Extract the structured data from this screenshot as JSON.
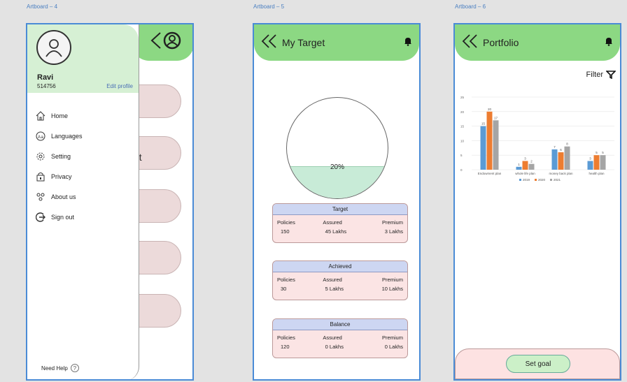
{
  "artboards": {
    "a4": "Artboard – 4",
    "a5": "Artboard – 5",
    "a6": "Artboard – 6"
  },
  "drawer": {
    "user_name": "Ravi",
    "user_id": "514756",
    "edit_profile": "Edit profile",
    "menu": [
      {
        "label": "Home",
        "icon": "home-icon"
      },
      {
        "label": "Languages",
        "icon": "languages-icon"
      },
      {
        "label": "Setting",
        "icon": "gear-icon"
      },
      {
        "label": "Privacy",
        "icon": "privacy-icon"
      },
      {
        "label": "About us",
        "icon": "about-icon"
      },
      {
        "label": "Sign out",
        "icon": "sign-out-icon"
      }
    ],
    "need_help": "Need Help",
    "help_glyph": "?",
    "behind_text": "nt"
  },
  "target": {
    "title": "My Target",
    "progress_label": "20%",
    "progress_fraction": 0.2,
    "cards": [
      {
        "heading": "Target",
        "labels": [
          "Policies",
          "Assured",
          "Premium"
        ],
        "values": [
          "150",
          "45 Lakhs",
          "3 Lakhs"
        ]
      },
      {
        "heading": "Achieved",
        "labels": [
          "Policies",
          "Assured",
          "Premium"
        ],
        "values": [
          "30",
          "5 Lakhs",
          "10 Lakhs"
        ]
      },
      {
        "heading": "Balance",
        "labels": [
          "Policies",
          "Assured",
          "Premium"
        ],
        "values": [
          "120",
          "0 Lakhs",
          "0 Lakhs"
        ]
      }
    ]
  },
  "portfolio": {
    "title": "Portfolio",
    "filter_label": "Filter",
    "set_goal": "Set goal"
  },
  "colors": {
    "header_green": "#8cd883",
    "bar_2019": "#5b9bd5",
    "bar_2020": "#ed7d31",
    "bar_2021": "#a5a5a5"
  },
  "chart_data": {
    "type": "bar",
    "categories": [
      "Endowment plan",
      "whole life plan",
      "money back plan",
      "health plan"
    ],
    "series": [
      {
        "name": "2019",
        "values": [
          15,
          1,
          7,
          3
        ]
      },
      {
        "name": "2020",
        "values": [
          20,
          3,
          6,
          5
        ]
      },
      {
        "name": "2021",
        "values": [
          17,
          2,
          8,
          5
        ]
      }
    ],
    "ylim": [
      0,
      25
    ],
    "yticks": [
      "0",
      "5",
      "10",
      "15",
      "20",
      "25"
    ],
    "legend": "bottom",
    "grid": true
  }
}
